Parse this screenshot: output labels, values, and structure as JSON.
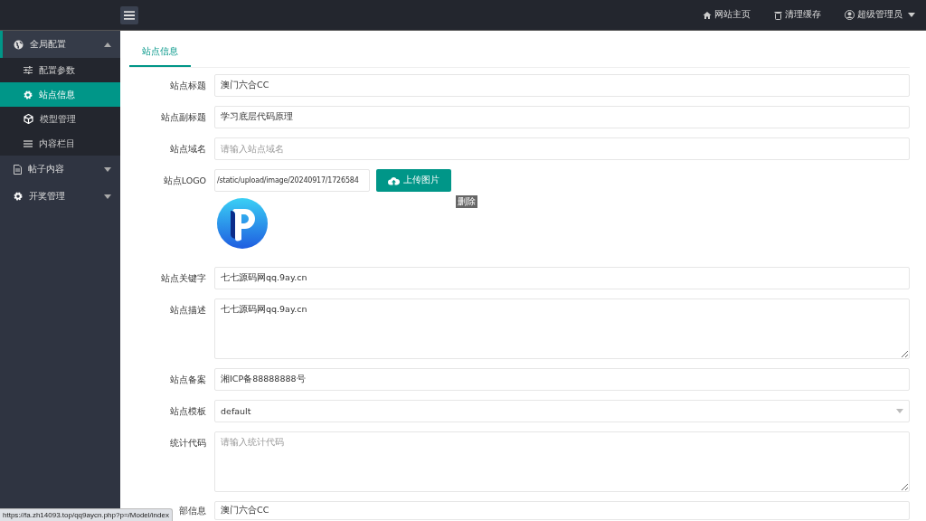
{
  "topbar": {
    "links": [
      {
        "kind": "home",
        "label": "网站主页",
        "dropdown": false
      },
      {
        "kind": "trash",
        "label": "清理缓存",
        "dropdown": false
      },
      {
        "kind": "user",
        "label": "超级管理员",
        "dropdown": true
      }
    ]
  },
  "sidebar": {
    "items": [
      {
        "kind": "globe",
        "label": "全局配置",
        "selected": true,
        "expanded": true,
        "children": [
          {
            "kind": "sliders",
            "label": "配置参数",
            "selected": false
          },
          {
            "kind": "gear",
            "label": "站点信息",
            "selected": true
          },
          {
            "kind": "cube",
            "label": "模型管理",
            "selected": false
          },
          {
            "kind": "list",
            "label": "内容栏目",
            "selected": false
          }
        ]
      },
      {
        "kind": "file",
        "label": "帖子内容",
        "selected": false,
        "expanded": false
      },
      {
        "kind": "gear",
        "label": "开奖管理",
        "selected": false,
        "expanded": false
      }
    ]
  },
  "tabs": [
    {
      "label": "站点信息",
      "selected": true
    }
  ],
  "fields": [
    {
      "kind": "input",
      "label": "站点标题",
      "value": "澳门六合CC"
    },
    {
      "kind": "input",
      "label": "站点副标题",
      "value": "学习底层代码原理"
    },
    {
      "kind": "input",
      "label": "站点域名",
      "placeholder": "请输入站点域名"
    },
    {
      "kind": "upload",
      "label": "站点LOGO",
      "value": "/static/upload/image/20240917/1726584",
      "button": "上传图片",
      "delete": "删除"
    },
    {
      "kind": "input",
      "label": "站点关键字",
      "value": "七七源码网qq.9ay.cn"
    },
    {
      "kind": "textarea",
      "label": "站点描述",
      "value": "七七源码网qq.9ay.cn"
    },
    {
      "kind": "input",
      "label": "站点备案",
      "value": "湘ICP备88888888号"
    },
    {
      "kind": "select",
      "label": "站点模板",
      "value": "default"
    },
    {
      "kind": "textarea",
      "label": "统计代码",
      "placeholder": "请输入统计代码"
    },
    {
      "kind": "input",
      "label": "部信息",
      "value": "澳门六合CC"
    }
  ],
  "status_url": "https://fa.zh14093.top/qq9aycn.php?p=/Model/index"
}
